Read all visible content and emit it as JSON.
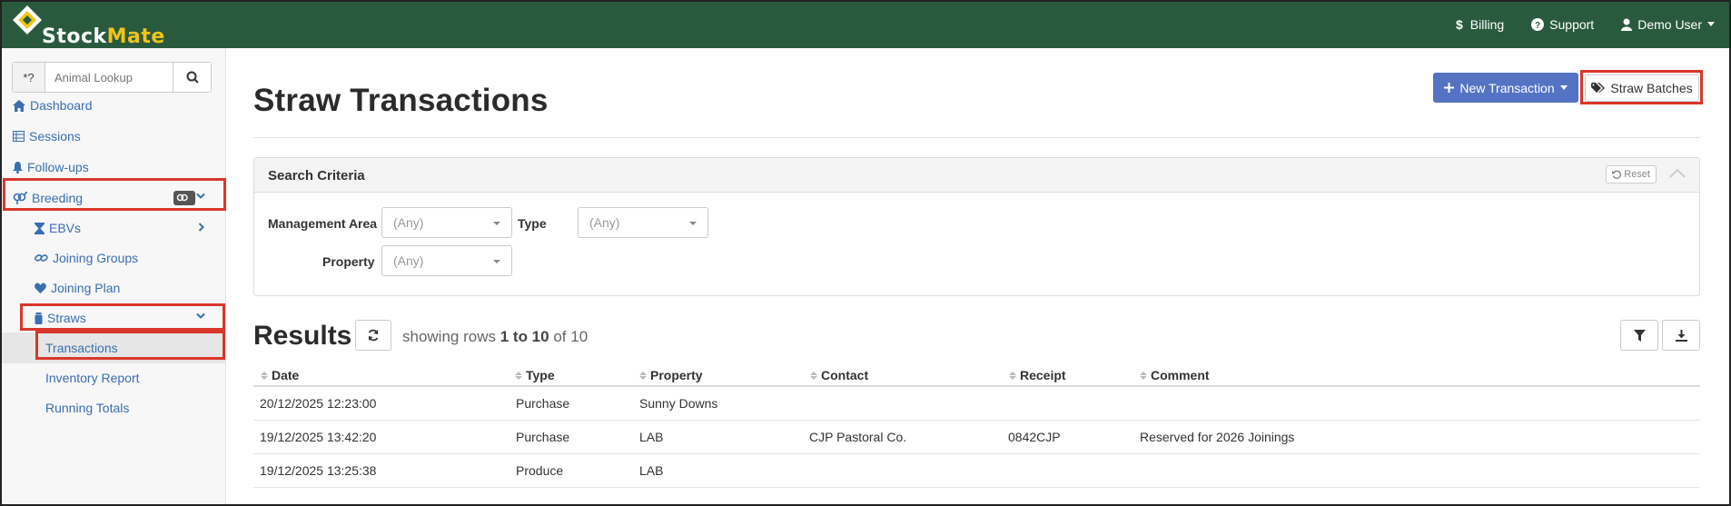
{
  "brand": {
    "part1": "Stock",
    "part2": "Mate"
  },
  "topnav": {
    "billing": "Billing",
    "support": "Support",
    "user": "Demo User"
  },
  "lookup": {
    "prefix": "*?",
    "placeholder": "Animal Lookup"
  },
  "sidebar": {
    "dashboard": "Dashboard",
    "sessions": "Sessions",
    "followups": "Follow-ups",
    "breeding": "Breeding",
    "ebvs": "EBVs",
    "joining_groups": "Joining Groups",
    "joining_plan": "Joining Plan",
    "straws": "Straws",
    "transactions": "Transactions",
    "inventory_report": "Inventory Report",
    "running_totals": "Running Totals"
  },
  "page": {
    "title": "Straw Transactions",
    "new_transaction": "New Transaction",
    "straw_batches": "Straw Batches"
  },
  "search": {
    "title": "Search Criteria",
    "reset": "Reset",
    "management_area_label": "Management Area",
    "management_area_value": "(Any)",
    "type_label": "Type",
    "type_value": "(Any)",
    "property_label": "Property",
    "property_value": "(Any)"
  },
  "results": {
    "title": "Results",
    "showing_prefix": "showing rows",
    "showing_range": "1 to 10",
    "showing_of": "of",
    "showing_total": "10"
  },
  "table": {
    "columns": [
      "Date",
      "Type",
      "Property",
      "Contact",
      "Receipt",
      "Comment"
    ],
    "rows": [
      [
        "20/12/2025 12:23:00",
        "Purchase",
        "Sunny Downs",
        "",
        "",
        ""
      ],
      [
        "19/12/2025 13:42:20",
        "Purchase",
        "LAB",
        "CJP Pastoral Co.",
        "0842CJP",
        "Reserved for 2026 Joinings"
      ],
      [
        "19/12/2025 13:25:38",
        "Produce",
        "LAB",
        "",
        "",
        ""
      ]
    ]
  },
  "colors": {
    "topbar": "#2a5a3d",
    "link": "#3a6fb0",
    "primary": "#5473c3",
    "highlight": "#d9372b",
    "logo_accent": "#f0c419"
  }
}
